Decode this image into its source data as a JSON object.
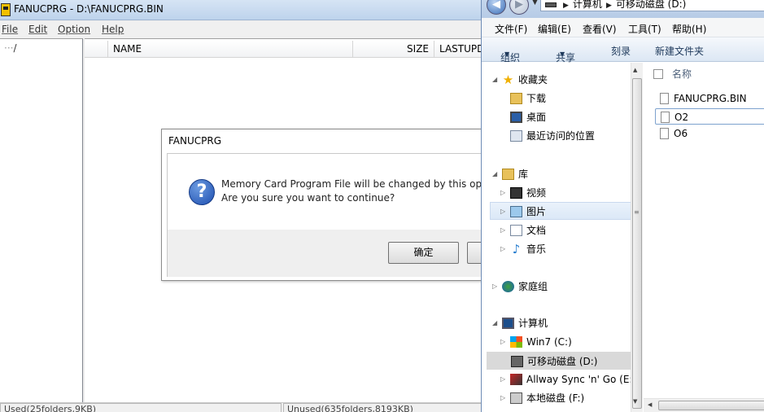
{
  "fanuc": {
    "title": "FANUCPRG - D:\\FANUCPRG.BIN",
    "menu": [
      "File",
      "Edit",
      "Option",
      "Help"
    ],
    "tree_root": "/",
    "columns": {
      "name": "NAME",
      "size": "SIZE",
      "lastupdate": "LASTUPD"
    },
    "status_used": "Used(25folders,9KB)",
    "status_unused": "Unused(635folders,8193KB)",
    "dialog": {
      "title": "FANUCPRG",
      "icon": "question-icon",
      "message_line1": "Memory Card Program File will be changed by this op",
      "message_line2": "Are you sure you want to continue?",
      "ok_label": "确定",
      "cancel_label": ""
    }
  },
  "explorer": {
    "nav_back_icon": "back-arrow-icon",
    "nav_forward_icon": "forward-arrow-icon",
    "address": {
      "part1": "计算机",
      "part2": "可移动磁盘 (D:)"
    },
    "menu": [
      "文件(F)",
      "编辑(E)",
      "查看(V)",
      "工具(T)",
      "帮助(H)"
    ],
    "commands": {
      "organize": "组织",
      "share": "共享",
      "burn": "刻录",
      "new_folder": "新建文件夹"
    },
    "nav_items": {
      "favorites": "收藏夹",
      "downloads": "下载",
      "desktop": "桌面",
      "recent": "最近访问的位置",
      "libraries": "库",
      "videos": "视频",
      "pictures": "图片",
      "documents": "文档",
      "music": "音乐",
      "homegroup": "家庭组",
      "computer": "计算机",
      "win7": "Win7 (C:)",
      "removable": "可移动磁盘 (D:)",
      "allway": "Allway Sync 'n' Go (E:)",
      "local": "本地磁盘 (F:)"
    },
    "file_header": "名称",
    "files": [
      "FANUCPRG.BIN",
      "O2",
      "O6"
    ]
  }
}
